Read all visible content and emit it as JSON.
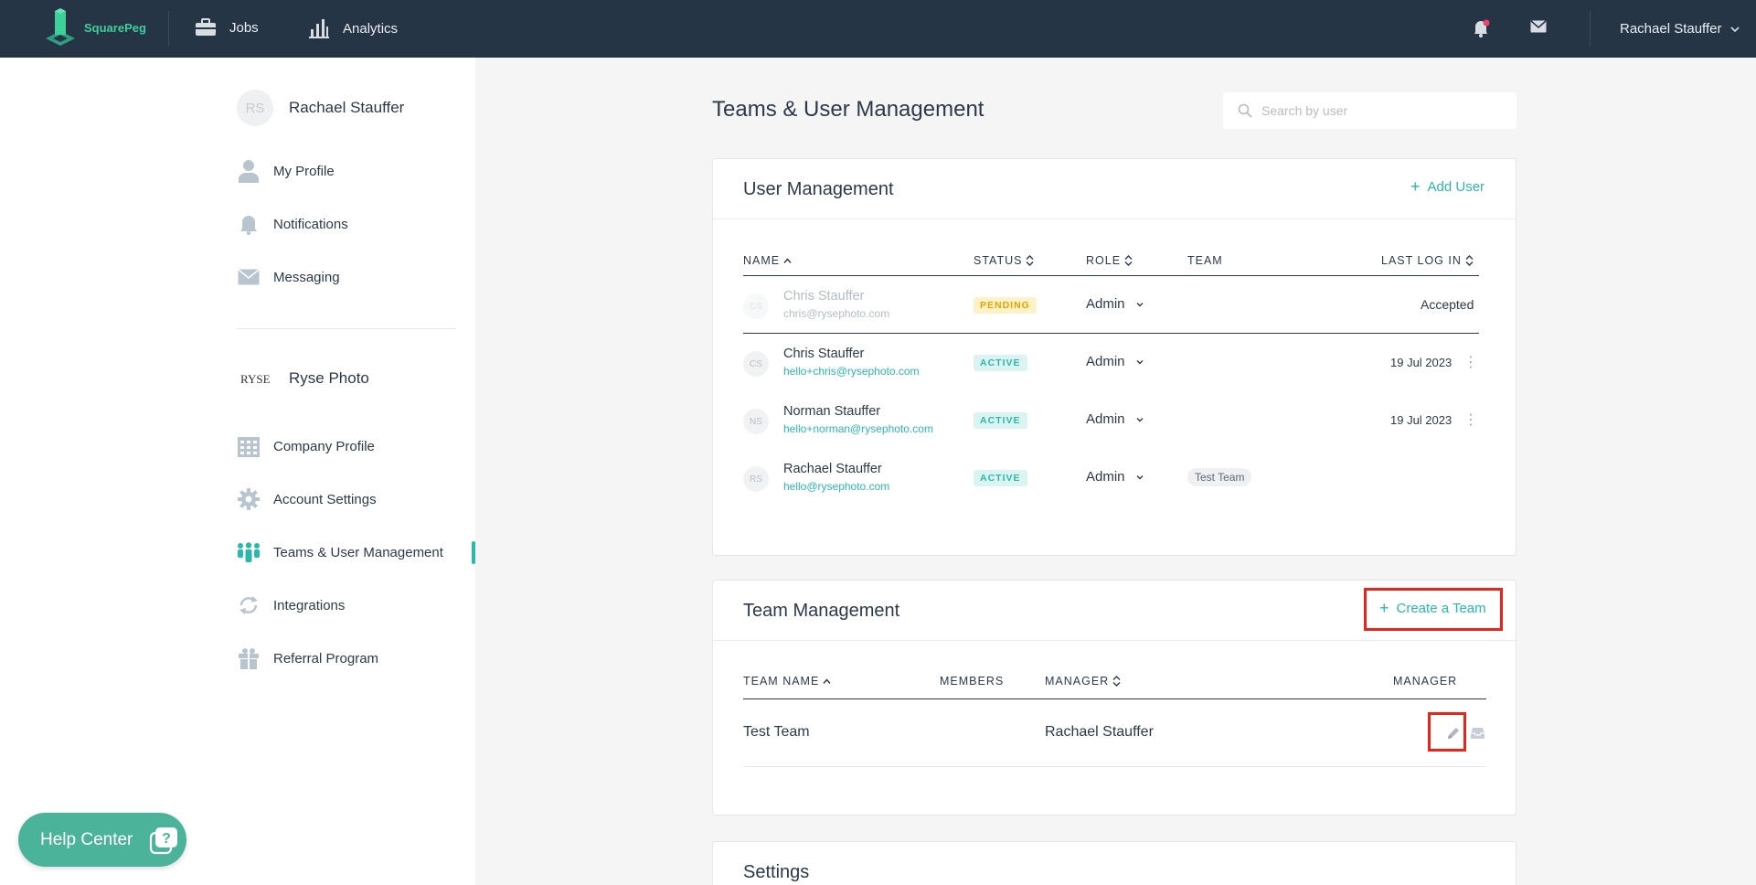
{
  "brand": {
    "name": "SquarePeg",
    "accent": "#2bb8ab"
  },
  "topnav": {
    "jobs": "Jobs",
    "analytics": "Analytics",
    "user": "Rachael Stauffer"
  },
  "sidebar": {
    "user": {
      "initials": "RS",
      "name": "Rachael Stauffer"
    },
    "personal_items": [
      {
        "label": "My Profile",
        "icon": "person-icon"
      },
      {
        "label": "Notifications",
        "icon": "bell-icon"
      },
      {
        "label": "Messaging",
        "icon": "envelope-icon"
      }
    ],
    "company": {
      "logo": "RYSE",
      "name": "Ryse Photo"
    },
    "company_items": [
      {
        "label": "Company Profile",
        "icon": "building-icon"
      },
      {
        "label": "Account Settings",
        "icon": "gear-icon"
      },
      {
        "label": "Teams & User Management",
        "icon": "team-icon"
      },
      {
        "label": "Integrations",
        "icon": "sync-icon"
      },
      {
        "label": "Referral Program",
        "icon": "gift-icon"
      }
    ]
  },
  "help": {
    "label": "Help Center"
  },
  "main": {
    "title": "Teams & User Management",
    "search_placeholder": "Search by user",
    "user_management": {
      "title": "User Management",
      "add_label": "Add User",
      "columns": {
        "name": "NAME",
        "status": "STATUS",
        "role": "ROLE",
        "team": "TEAM",
        "last_log_in": "LAST LOG IN"
      },
      "rows": [
        {
          "initials": "CS",
          "name": "Chris Stauffer",
          "email": "chris@rysephoto.com",
          "status": "PENDING",
          "role": "Admin",
          "team": "",
          "last": "Accepted"
        },
        {
          "initials": "CS",
          "name": "Chris Stauffer",
          "email": "hello+chris@rysephoto.com",
          "status": "ACTIVE",
          "role": "Admin",
          "team": "",
          "last": "19 Jul 2023"
        },
        {
          "initials": "NS",
          "name": "Norman Stauffer",
          "email": "hello+norman@rysephoto.com",
          "status": "ACTIVE",
          "role": "Admin",
          "team": "",
          "last": "19 Jul 2023"
        },
        {
          "initials": "RS",
          "name": "Rachael Stauffer",
          "email": "hello@rysephoto.com",
          "status": "ACTIVE",
          "role": "Admin",
          "team": "Test Team",
          "last": ""
        }
      ]
    },
    "team_management": {
      "title": "Team Management",
      "create_label": "Create a Team",
      "columns": {
        "team_name": "TEAM NAME",
        "members": "MEMBERS",
        "manager": "MANAGER",
        "manager2": "MANAGER"
      },
      "rows": [
        {
          "team_name": "Test Team",
          "members": "",
          "manager": "Rachael Stauffer"
        }
      ]
    },
    "settings": {
      "title": "Settings"
    }
  }
}
